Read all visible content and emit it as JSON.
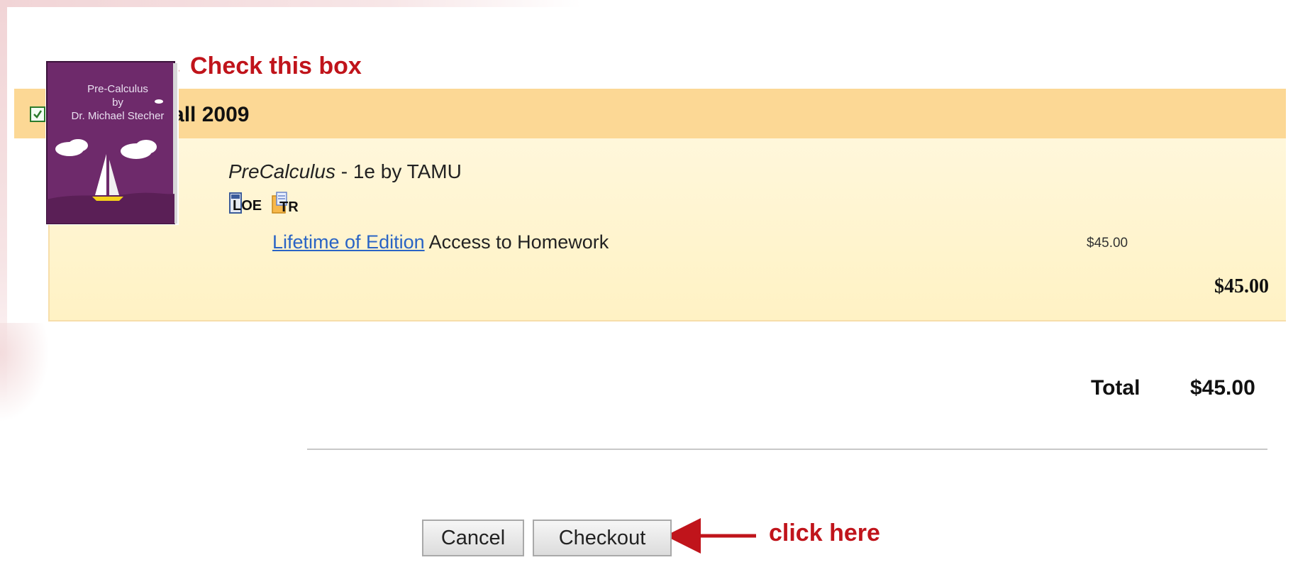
{
  "annotations": {
    "check_box_hint": "Check this box",
    "click_hint": "click here"
  },
  "cart_group": {
    "title": "Math 150 Fall 2009",
    "checked": true,
    "item": {
      "cover_text": "Pre-Calculus\nby\nDr. Michael Stecher",
      "title_italic": "PreCalculus",
      "title_rest": " - 1e by TAMU",
      "badges": [
        "LOE",
        "TR"
      ],
      "access_link": "Lifetime of Edition",
      "access_text": " Access to Homework",
      "price": "$45.00",
      "subtotal": "$45.00"
    }
  },
  "summary": {
    "total_label": "Total",
    "total_value": "$45.00"
  },
  "buttons": {
    "cancel": "Cancel",
    "checkout": "Checkout"
  },
  "colors": {
    "annotation_red": "#c0141b",
    "header_bg": "#fcd895",
    "body_bg": "#fff4cc",
    "link_blue": "#2a64c5",
    "checkbox_green": "#2c7b2c",
    "cover_purple": "#6e2a6b"
  }
}
